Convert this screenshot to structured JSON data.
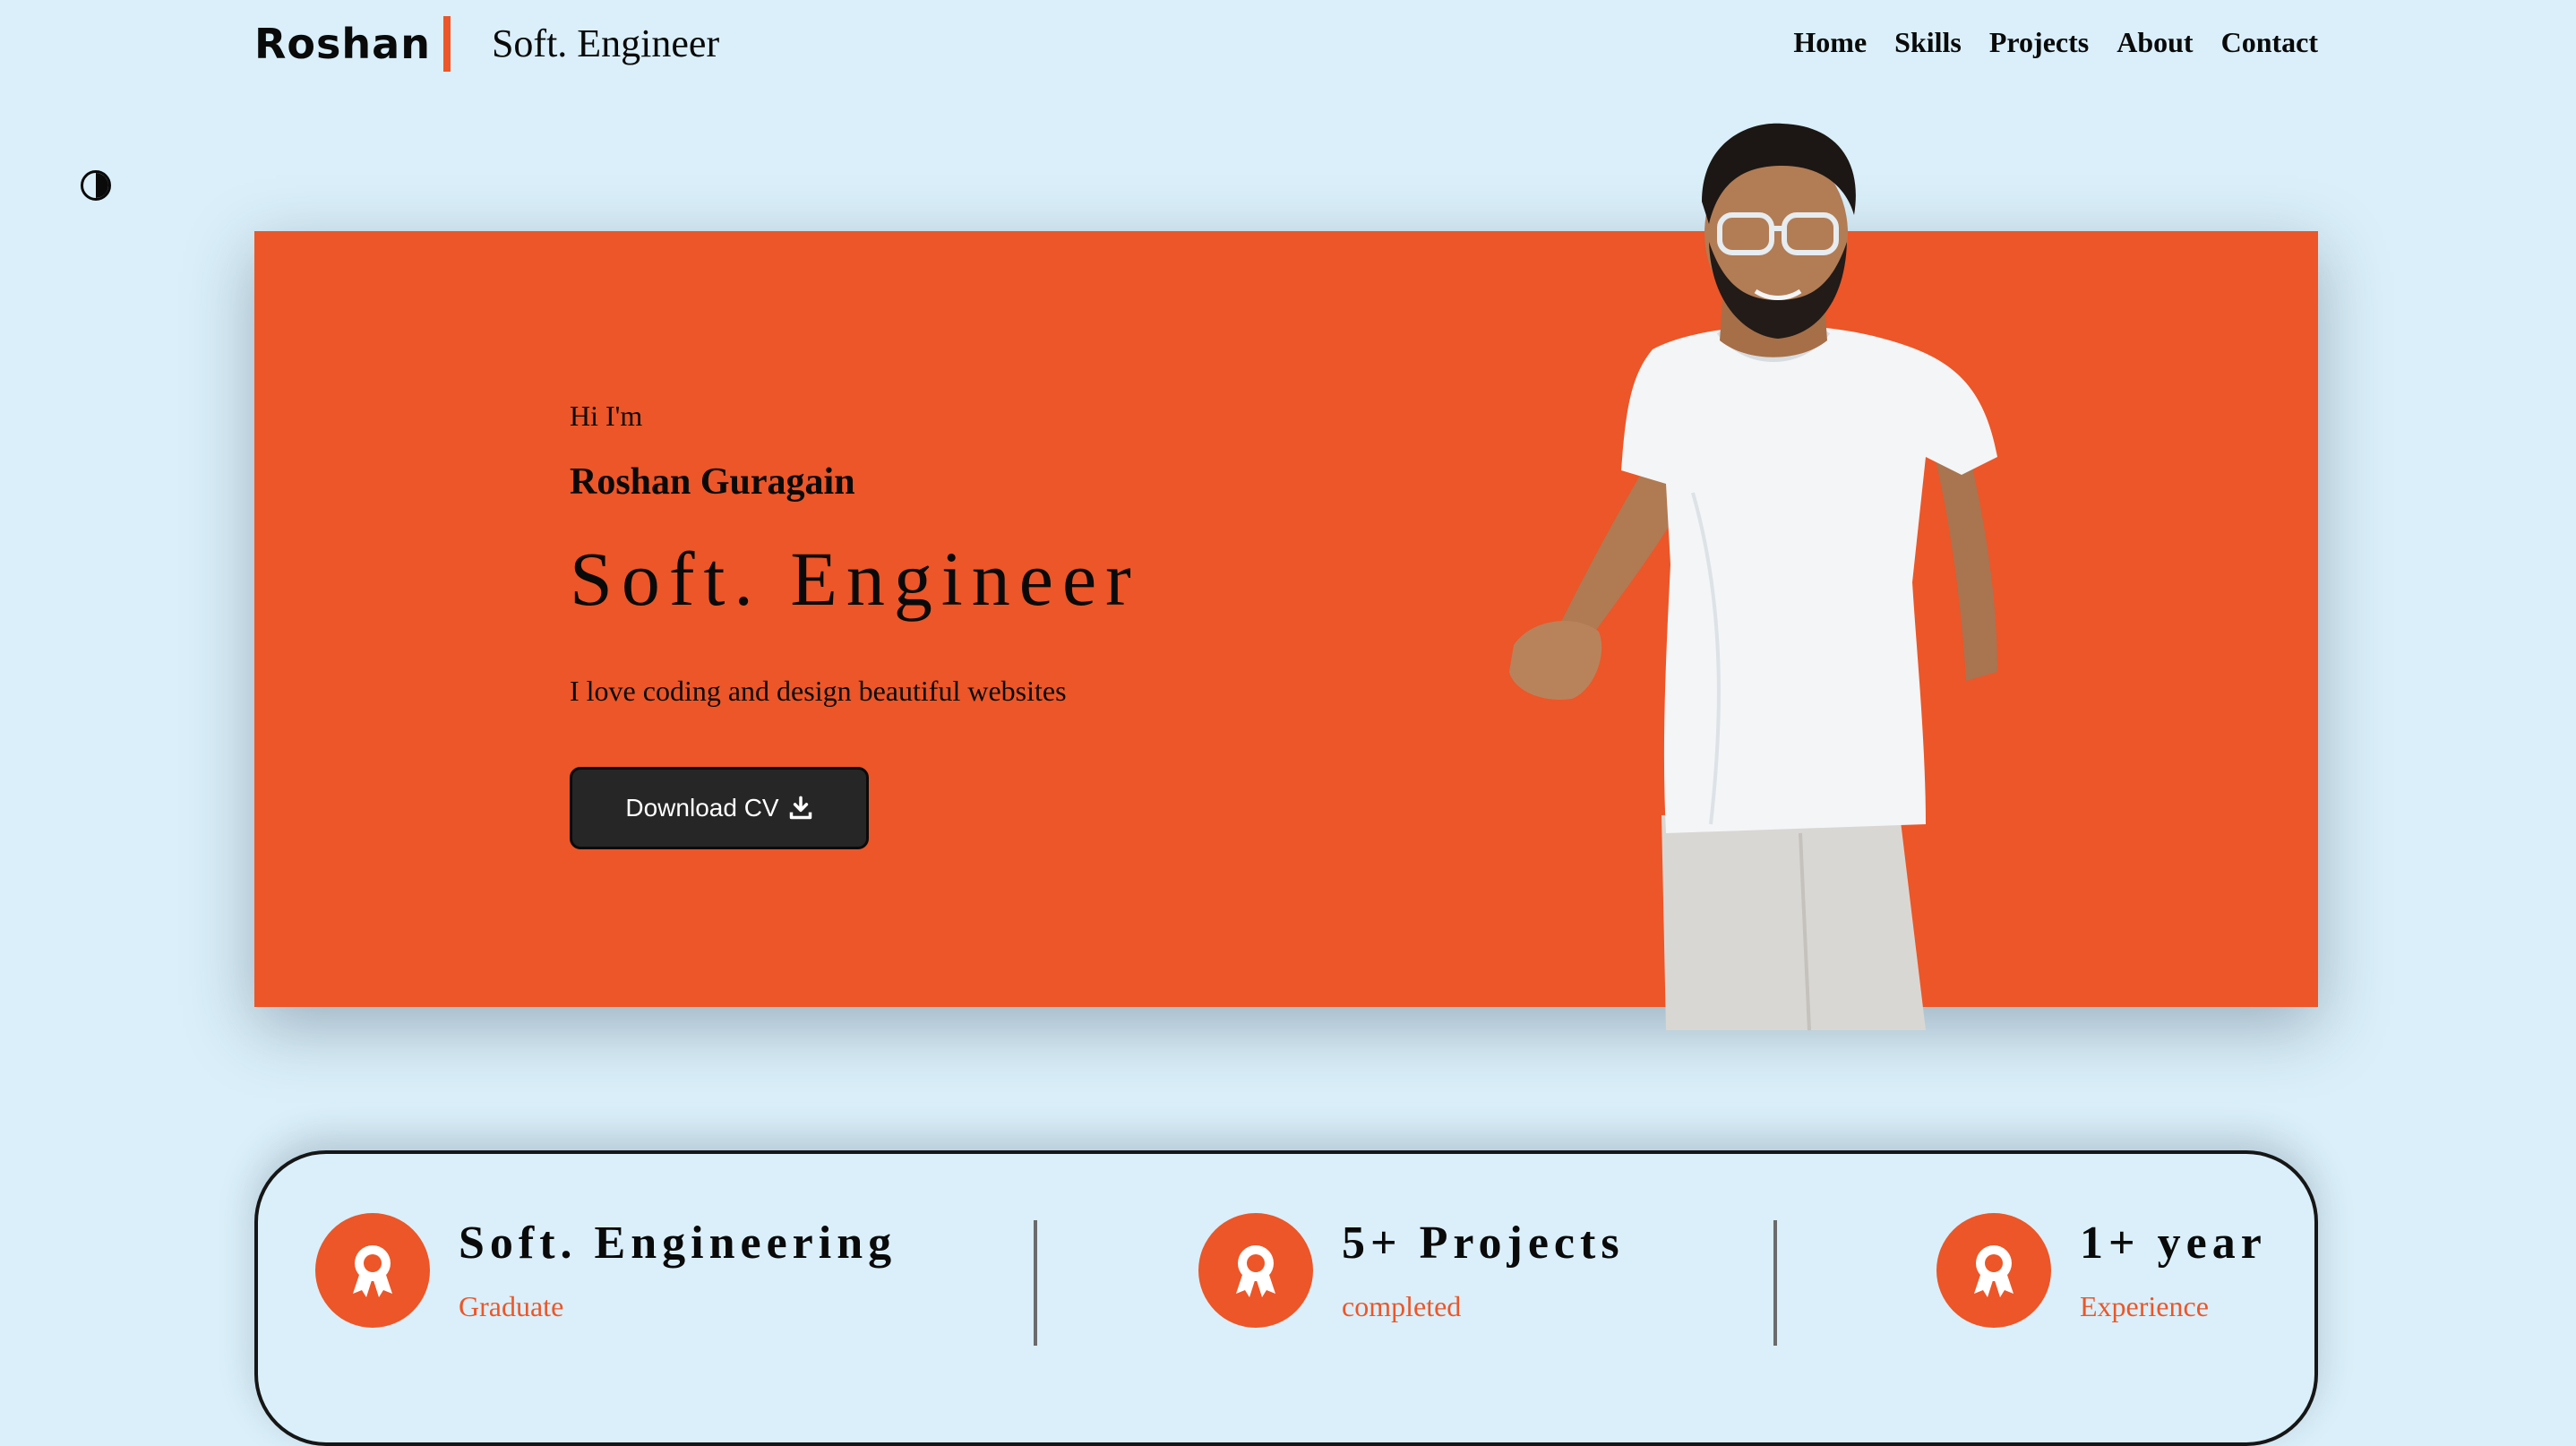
{
  "brand": {
    "name": "Roshan",
    "title": "Soft. Engineer",
    "accent_color": "#ec5628"
  },
  "nav": {
    "items": [
      {
        "label": "Home"
      },
      {
        "label": "Skills"
      },
      {
        "label": "Projects"
      },
      {
        "label": "About"
      },
      {
        "label": "Contact"
      }
    ]
  },
  "theme_toggle": {
    "icon": "contrast-icon"
  },
  "hero": {
    "greeting": "Hi I'm",
    "name": "Roshan Guragain",
    "role": "Soft. Engineer",
    "tagline": "I love coding and design beautiful websites",
    "cta_label": "Download CV",
    "cta_icon": "download-icon",
    "background_color": "#ec5628"
  },
  "stats": [
    {
      "title": "Soft. Engineering",
      "subtitle": "Graduate",
      "icon": "award-icon"
    },
    {
      "title": "5+ Projects",
      "subtitle": "completed",
      "icon": "award-icon"
    },
    {
      "title": "1+ year",
      "subtitle": "Experience",
      "icon": "award-icon"
    }
  ]
}
